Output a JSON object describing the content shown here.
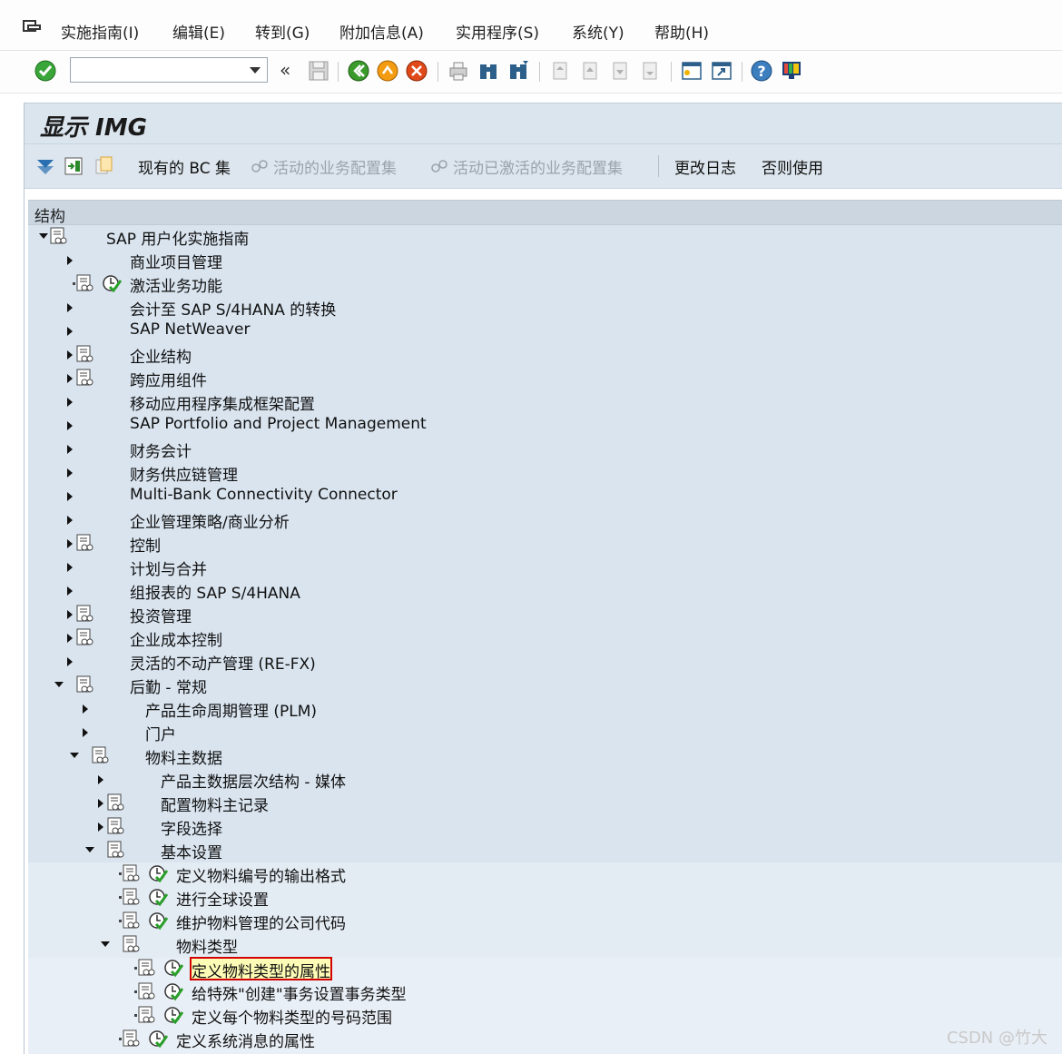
{
  "menubar": {
    "items": [
      {
        "label": "实施指南(I)"
      },
      {
        "label": "编辑(E)"
      },
      {
        "label": "转到(G)"
      },
      {
        "label": "附加信息(A)"
      },
      {
        "label": "实用程序(S)"
      },
      {
        "label": "系统(Y)"
      },
      {
        "label": "帮助(H)"
      }
    ]
  },
  "toolbar": {
    "command_value": "",
    "back_glyph": "«"
  },
  "title": "显示 IMG",
  "app_toolbar": {
    "current_bc_set": "现有的 BC 集",
    "active_bc_sets": "活动的业务配置集",
    "active_activated_bc_sets": "活动已激活的业务配置集",
    "change_log": "更改日志",
    "otherwise_use": "否则使用"
  },
  "tree": {
    "header": "结构",
    "nodes": [
      {
        "label": "SAP 用户化实施指南"
      },
      {
        "label": "商业项目管理"
      },
      {
        "label": "激活业务功能"
      },
      {
        "label": "会计至 SAP S/4HANA 的转换"
      },
      {
        "label": "SAP NetWeaver"
      },
      {
        "label": "企业结构"
      },
      {
        "label": "跨应用组件"
      },
      {
        "label": "移动应用程序集成框架配置"
      },
      {
        "label": "SAP Portfolio and Project Management"
      },
      {
        "label": "财务会计"
      },
      {
        "label": "财务供应链管理"
      },
      {
        "label": "Multi-Bank Connectivity Connector"
      },
      {
        "label": "企业管理策略/商业分析"
      },
      {
        "label": "控制"
      },
      {
        "label": "计划与合并"
      },
      {
        "label": "组报表的 SAP S/4HANA"
      },
      {
        "label": "投资管理"
      },
      {
        "label": "企业成本控制"
      },
      {
        "label": "灵活的不动产管理 (RE-FX)"
      },
      {
        "label": "后勤 - 常规"
      },
      {
        "label": "产品生命周期管理 (PLM)"
      },
      {
        "label": "门户"
      },
      {
        "label": "物料主数据"
      },
      {
        "label": "产品主数据层次结构 - 媒体"
      },
      {
        "label": "配置物料主记录"
      },
      {
        "label": "字段选择"
      },
      {
        "label": "基本设置"
      },
      {
        "label": "定义物料编号的输出格式"
      },
      {
        "label": "进行全球设置"
      },
      {
        "label": "维护物料管理的公司代码"
      },
      {
        "label": "物料类型"
      },
      {
        "label": "定义物料类型的属性"
      },
      {
        "label": "给特殊\"创建\"事务设置事务类型"
      },
      {
        "label": "定义每个物料类型的号码范围"
      },
      {
        "label": "定义系统消息的属性"
      }
    ]
  },
  "watermark": "CSDN @竹大"
}
